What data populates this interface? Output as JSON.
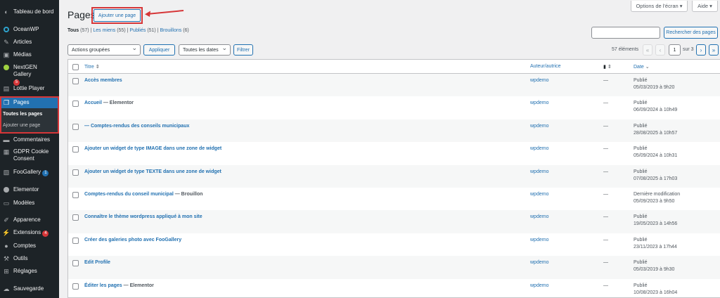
{
  "sidebar": {
    "items": [
      {
        "label": "Tableau de bord",
        "icon": "dashboard-icon"
      },
      {
        "label": "OceanWP",
        "icon": "oceanwp-icon"
      },
      {
        "label": "Articles",
        "icon": "pin-icon"
      },
      {
        "label": "Médias",
        "icon": "media-icon"
      },
      {
        "label": "NextGEN Gallery",
        "icon": "nextgen-icon",
        "badge": "5"
      },
      {
        "label": "Lottie Player",
        "icon": "lottie-icon"
      },
      {
        "label": "Pages",
        "icon": "pages-icon"
      },
      {
        "label": "Commentaires",
        "icon": "comment-icon"
      },
      {
        "label": "GDPR Cookie Consent",
        "icon": "gdpr-icon"
      },
      {
        "label": "FooGallery",
        "icon": "foogallery-icon",
        "badge": "1"
      },
      {
        "label": "Elementor",
        "icon": "elementor-icon"
      },
      {
        "label": "Modèles",
        "icon": "templates-icon"
      },
      {
        "label": "Apparence",
        "icon": "brush-icon"
      },
      {
        "label": "Extensions",
        "icon": "plugin-icon",
        "badge": "4"
      },
      {
        "label": "Comptes",
        "icon": "users-icon"
      },
      {
        "label": "Outils",
        "icon": "wrench-icon"
      },
      {
        "label": "Réglages",
        "icon": "settings-icon"
      },
      {
        "label": "Sauvegarde",
        "icon": "backup-icon"
      }
    ],
    "submenu": [
      "Toutes les pages",
      "Ajouter une page"
    ]
  },
  "topbar": {
    "screen_options": "Options de l'écran",
    "help": "Aide"
  },
  "header": {
    "title": "Pages",
    "add_button": "Ajouter une page"
  },
  "filters": {
    "all": "Tous",
    "all_count": "(57)",
    "mine": "Les miens",
    "mine_count": "(55)",
    "published": "Publiés",
    "published_count": "(51)",
    "drafts": "Brouillons",
    "drafts_count": "(6)",
    "sep": "|"
  },
  "search": {
    "button": "Rechercher des pages",
    "value": ""
  },
  "bulk": {
    "actions": "Actions groupées",
    "apply": "Appliquer",
    "dates": "Toutes les dates",
    "filter": "Filtrer"
  },
  "pagination": {
    "count": "57 éléments",
    "first": "«",
    "prev": "‹",
    "current": "1",
    "of": "sur 3",
    "next": "›",
    "last": "»"
  },
  "table": {
    "columns": {
      "title": "Titre",
      "author": "Auteur/autrice",
      "date": "Date"
    },
    "rows": [
      {
        "title": "Accès membres",
        "state": "",
        "author": "wpdemo",
        "comments": "—",
        "status": "Publié",
        "date": "05/03/2019 à 9h20"
      },
      {
        "title": "Accueil",
        "state": " — Elementor",
        "author": "wpdemo",
        "comments": "—",
        "status": "Publié",
        "date": "06/09/2024 à 10h49"
      },
      {
        "title": "— Comptes-rendus des conseils municipaux",
        "state": "",
        "author": "wpdemo",
        "comments": "—",
        "status": "Publié",
        "date": "28/08/2025 à 10h57"
      },
      {
        "title": "Ajouter un widget de type IMAGE dans une zone de widget",
        "state": "",
        "author": "wpdemo",
        "comments": "—",
        "status": "Publié",
        "date": "05/09/2024 à 10h31"
      },
      {
        "title": "Ajouter un widget de type TEXTE dans une zone de widget",
        "state": "",
        "author": "wpdemo",
        "comments": "—",
        "status": "Publié",
        "date": "07/08/2025 à 17h03"
      },
      {
        "title": "Comptes-rendus du conseil municipal",
        "state": " — Brouillon",
        "author": "wpdemo",
        "comments": "—",
        "status": "Dernière modification",
        "date": "05/09/2023 à 9h50"
      },
      {
        "title": "Connaître le thème wordpress appliqué à mon site",
        "state": "",
        "author": "wpdemo",
        "comments": "—",
        "status": "Publié",
        "date": "19/05/2023 à 14h56"
      },
      {
        "title": "Créer des galeries photo avec FooGallery",
        "state": "",
        "author": "wpdemo",
        "comments": "—",
        "status": "Publié",
        "date": "23/11/2023 à 17h44"
      },
      {
        "title": "Edit Profile",
        "state": "",
        "author": "wpdemo",
        "comments": "—",
        "status": "Publié",
        "date": "05/03/2019 à 9h30"
      },
      {
        "title": "Éditer les pages",
        "state": " — Elementor",
        "author": "wpdemo",
        "comments": "—",
        "status": "Publié",
        "date": "10/08/2023 à 16h04"
      }
    ]
  },
  "colors": {
    "sidebar_bg": "#1d2327",
    "accent": "#2271b1",
    "highlight": "#d63638"
  }
}
